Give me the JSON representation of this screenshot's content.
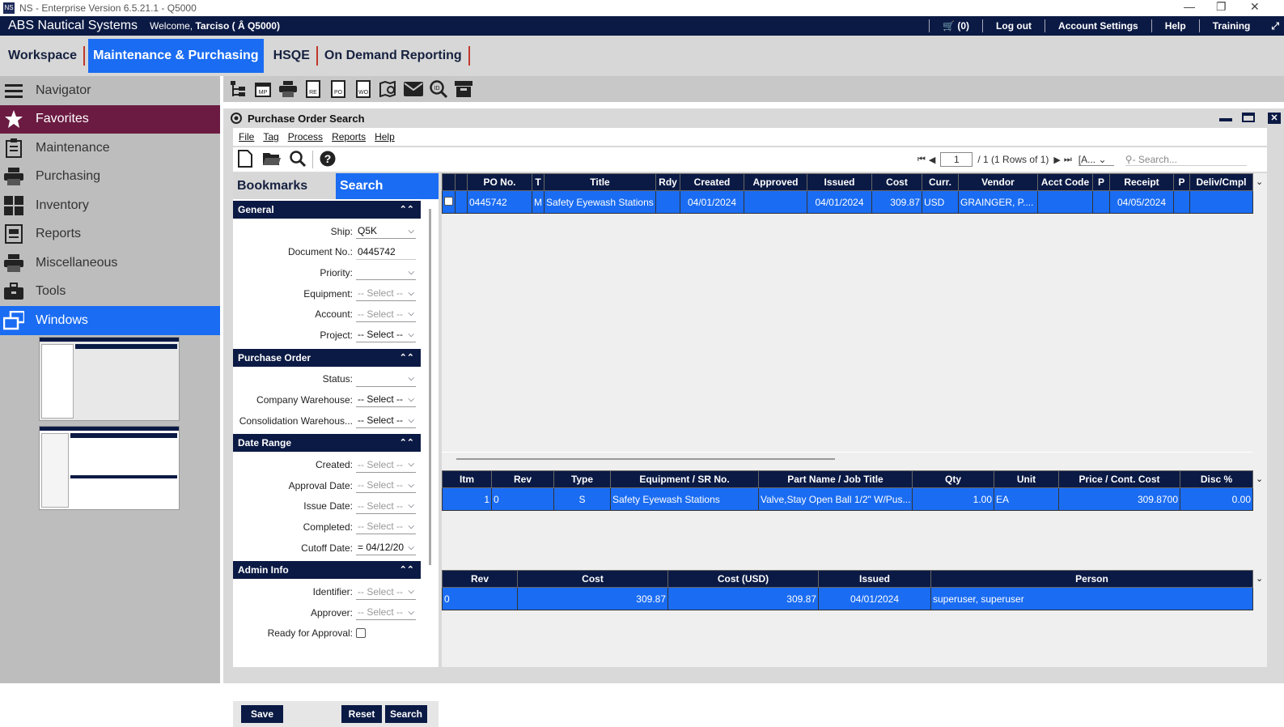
{
  "window": {
    "title": "NS - Enterprise Version 6.5.21.1 - Q5000",
    "logo": "NS"
  },
  "topbar": {
    "brand": "ABS Nautical Systems",
    "welcome_prefix": "Welcome,",
    "user": "Tarciso",
    "ship": "( Â Q5000)",
    "cart": "(0)",
    "links": [
      "Log out",
      "Account Settings",
      "Help",
      "Training"
    ]
  },
  "modules": [
    {
      "label": "Workspace",
      "active": false
    },
    {
      "label": "Maintenance & Purchasing",
      "active": true
    },
    {
      "label": "HSQE",
      "active": false
    },
    {
      "label": "On Demand Reporting",
      "active": false
    }
  ],
  "sidebar": {
    "items": [
      {
        "label": "Navigator",
        "icon": "menu-icon"
      },
      {
        "label": "Favorites",
        "icon": "star-icon"
      },
      {
        "label": "Maintenance",
        "icon": "clipboard-icon"
      },
      {
        "label": "Purchasing",
        "icon": "printer-icon"
      },
      {
        "label": "Inventory",
        "icon": "grid-icon"
      },
      {
        "label": "Reports",
        "icon": "report-icon"
      },
      {
        "label": "Miscellaneous",
        "icon": "printer-icon"
      },
      {
        "label": "Tools",
        "icon": "toolbox-icon"
      },
      {
        "label": "Windows",
        "icon": "windows-icon"
      }
    ]
  },
  "panel": {
    "title": "Purchase Order Search",
    "menu": [
      "File",
      "Tag",
      "Process",
      "Reports",
      "Help"
    ]
  },
  "pager": {
    "page": "1",
    "total": "/ 1 (1 Rows of 1)",
    "filter": "[A...",
    "search_placeholder": "Search..."
  },
  "left": {
    "tabs": [
      "Bookmarks",
      "Search"
    ],
    "general": {
      "title": "General",
      "fields": [
        {
          "label": "Ship:",
          "value": "Q5K",
          "gray": false
        },
        {
          "label": "Document No.:",
          "value": "0445742",
          "gray": false,
          "text": true
        },
        {
          "label": "Priority:",
          "value": "",
          "gray": false
        },
        {
          "label": "Equipment:",
          "value": "-- Select --",
          "gray": true
        },
        {
          "label": "Account:",
          "value": "-- Select --",
          "gray": true
        },
        {
          "label": "Project:",
          "value": "-- Select --",
          "gray": false
        }
      ]
    },
    "po": {
      "title": "Purchase Order",
      "fields": [
        {
          "label": "Status:",
          "value": "",
          "gray": false
        },
        {
          "label": "Company Warehouse:",
          "value": "-- Select --",
          "gray": false
        },
        {
          "label": "Consolidation Warehous...",
          "value": "-- Select --",
          "gray": false
        }
      ]
    },
    "dates": {
      "title": "Date Range",
      "fields": [
        {
          "label": "Created:",
          "value": "-- Select --",
          "gray": true
        },
        {
          "label": "Approval Date:",
          "value": "-- Select --",
          "gray": true
        },
        {
          "label": "Issue Date:",
          "value": "-- Select --",
          "gray": true
        },
        {
          "label": "Completed:",
          "value": "-- Select --",
          "gray": true
        },
        {
          "label": "Cutoff Date:",
          "value": "= 04/12/20",
          "gray": false
        }
      ]
    },
    "admin": {
      "title": "Admin Info",
      "fields": [
        {
          "label": "Identifier:",
          "value": "-- Select --",
          "gray": true
        },
        {
          "label": "Approver:",
          "value": "-- Select --",
          "gray": true
        }
      ],
      "ready": "Ready for Approval:"
    },
    "buttons": {
      "save": "Save",
      "reset": "Reset",
      "search": "Search"
    }
  },
  "grid1": {
    "headers": [
      "",
      "",
      "PO No.",
      "T",
      "Title",
      "Rdy",
      "Created",
      "Approved",
      "Issued",
      "Cost",
      "Curr.",
      "Vendor",
      "Acct Code",
      "P",
      "Receipt",
      "P",
      "Deliv/Cmpl"
    ],
    "rows": [
      [
        "",
        "",
        "0445742",
        "M",
        "Safety Eyewash Stations",
        "",
        "04/01/2024",
        "",
        "04/01/2024",
        "309.87",
        "USD",
        "GRAINGER, P....",
        "",
        "",
        "04/05/2024",
        "",
        ""
      ]
    ]
  },
  "grid2": {
    "headers": [
      "Itm",
      "Rev",
      "Type",
      "Equipment / SR No.",
      "Part Name / Job Title",
      "Qty",
      "Unit",
      "Price / Cont. Cost",
      "Disc %"
    ],
    "rows": [
      [
        "1",
        "0",
        "S",
        "Safety Eyewash Stations",
        "Valve,Stay Open Ball 1/2\" W/Pus...",
        "1.00",
        "EA",
        "309.8700",
        "0.00"
      ]
    ]
  },
  "grid3": {
    "headers": [
      "Rev",
      "Cost",
      "Cost (USD)",
      "Issued",
      "Person"
    ],
    "rows": [
      [
        "0",
        "309.87",
        "309.87",
        "04/01/2024",
        "superuser, superuser"
      ]
    ]
  }
}
